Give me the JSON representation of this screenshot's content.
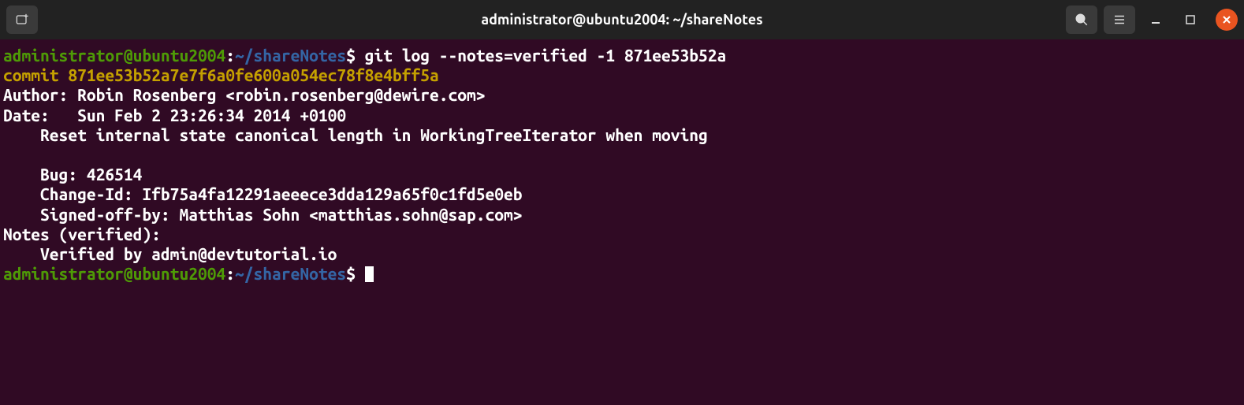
{
  "window": {
    "title": "administrator@ubuntu2004: ~/shareNotes"
  },
  "prompt1": {
    "user_host": "administrator@ubuntu2004",
    "colon": ":",
    "path": "~/shareNotes",
    "dollar": "$",
    "command": " git log --notes=verified -1 871ee53b52a"
  },
  "output": {
    "commit_line": "commit 871ee53b52a7e7f6a0fe600a054ec78f8e4bff5a",
    "author": "Author: Robin Rosenberg <robin.rosenberg@dewire.com>",
    "date": "Date:   Sun Feb 2 23:26:34 2014 +0100",
    "blank1": "",
    "subject": "    Reset internal state canonical length in WorkingTreeIterator when moving",
    "blank2": "    ",
    "bug": "    Bug: 426514",
    "changeid": "    Change-Id: Ifb75a4fa12291aeeece3dda129a65f0c1fd5e0eb",
    "signoff": "    Signed-off-by: Matthias Sohn <matthias.sohn@sap.com>",
    "blank3": "",
    "notes_header": "Notes (verified):",
    "notes_body": "    Verified by admin@devtutorial.io"
  },
  "prompt2": {
    "user_host": "administrator@ubuntu2004",
    "colon": ":",
    "path": "~/shareNotes",
    "dollar": "$",
    "command": " "
  }
}
